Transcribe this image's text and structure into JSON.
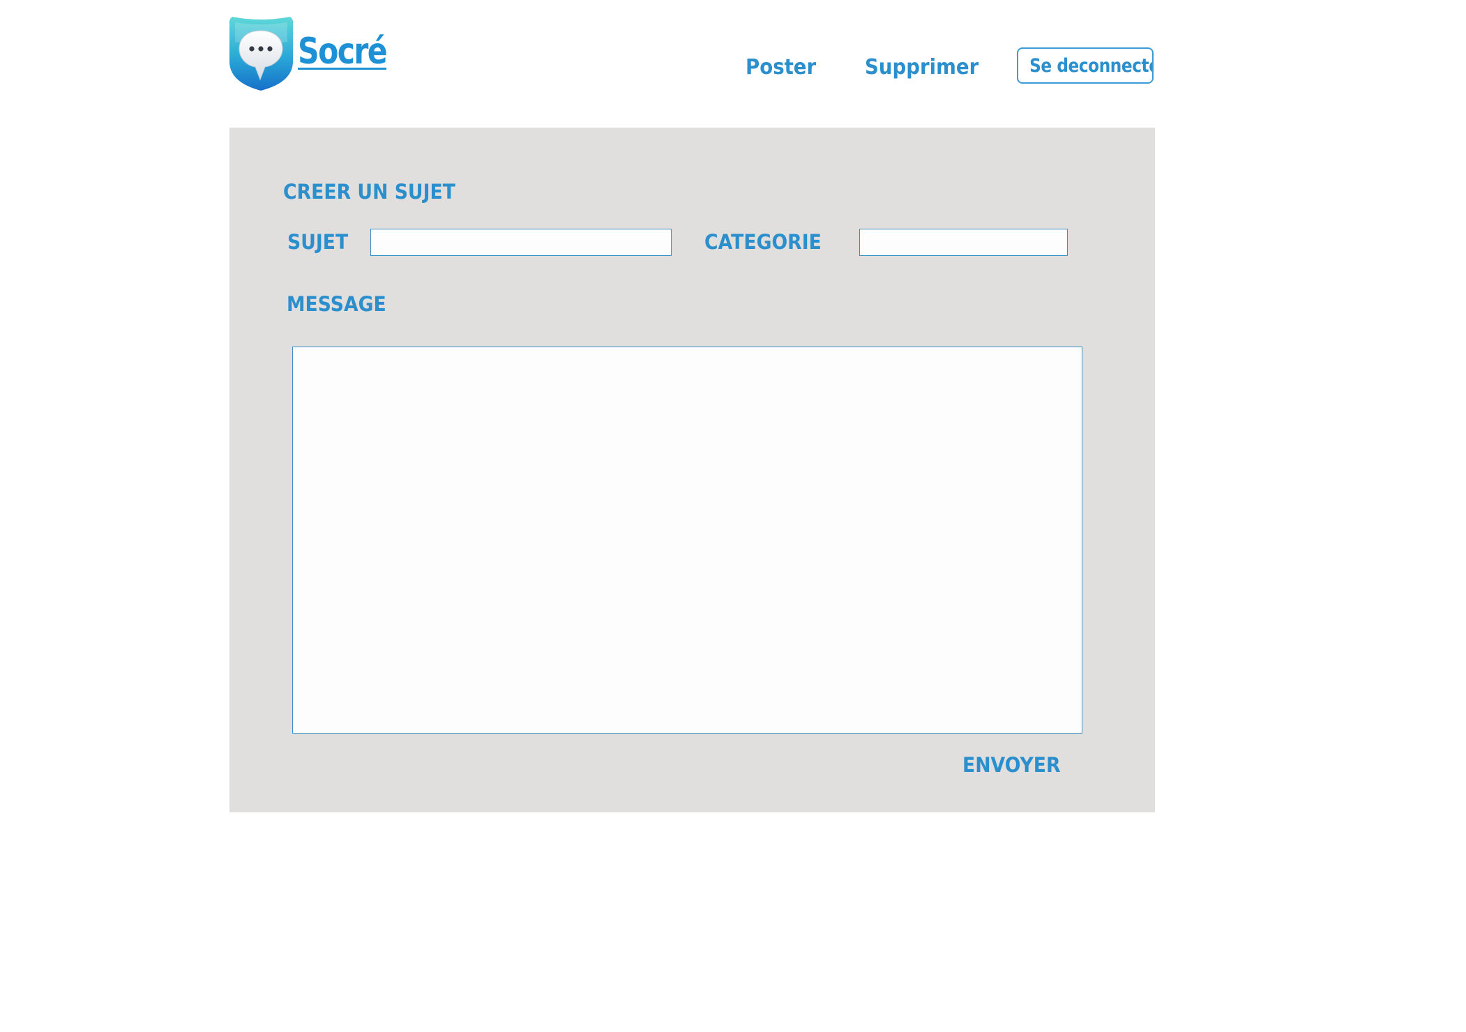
{
  "header": {
    "logo_text": "Socré",
    "nav": {
      "poster_label": "Poster",
      "supprimer_label": "Supprimer"
    },
    "logout_label": "Se deconnecter"
  },
  "form": {
    "title": "CREER UN SUJET",
    "subject_label": "SUJET",
    "subject_value": "",
    "category_label": "CATEGORIE",
    "category_value": "",
    "message_label": "MESSAGE",
    "message_value": "",
    "send_label": "ENVOYER"
  },
  "colors": {
    "accent": "#2a8fcc",
    "panel_background": "#e1dede",
    "page_background": "#ffffff",
    "logo_gradient_top": "#4fd0d6",
    "logo_gradient_bottom": "#1a7ed0"
  },
  "icons": {
    "logo": "chat-bubble-shield-icon"
  }
}
